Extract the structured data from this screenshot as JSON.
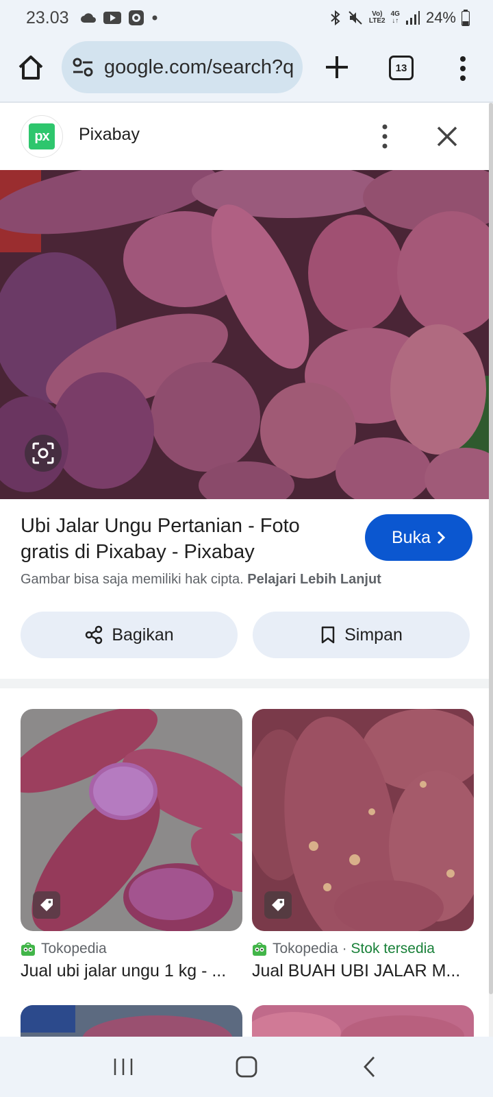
{
  "status_bar": {
    "time": "23.03",
    "network_top": "Vo)",
    "network_bottom": "LTE2",
    "data_type": "4G",
    "battery": "24%"
  },
  "browser": {
    "url": "google.com/search?q",
    "tab_count": "13"
  },
  "source": {
    "name": "Pixabay",
    "logo_text": "px",
    "logo_color": "#2ec66d"
  },
  "result": {
    "title": "Ubi Jalar Ungu Pertanian - Foto gratis di Pixabay - Pixabay",
    "open_label": "Buka",
    "copyright_text": "Gambar bisa saja memiliki hak cipta.",
    "learn_more": "Pelajari Lebih Lanjut",
    "share_label": "Bagikan",
    "save_label": "Simpan"
  },
  "related": [
    {
      "source": "Tokopedia",
      "stock": "",
      "title": "Jual ubi jalar ungu 1 kg - ..."
    },
    {
      "source": "Tokopedia",
      "stock": "Stok tersedia",
      "title": "Jual BUAH UBI JALAR M..."
    }
  ],
  "colors": {
    "accent": "#0b57d0",
    "stock_green": "#188038"
  }
}
